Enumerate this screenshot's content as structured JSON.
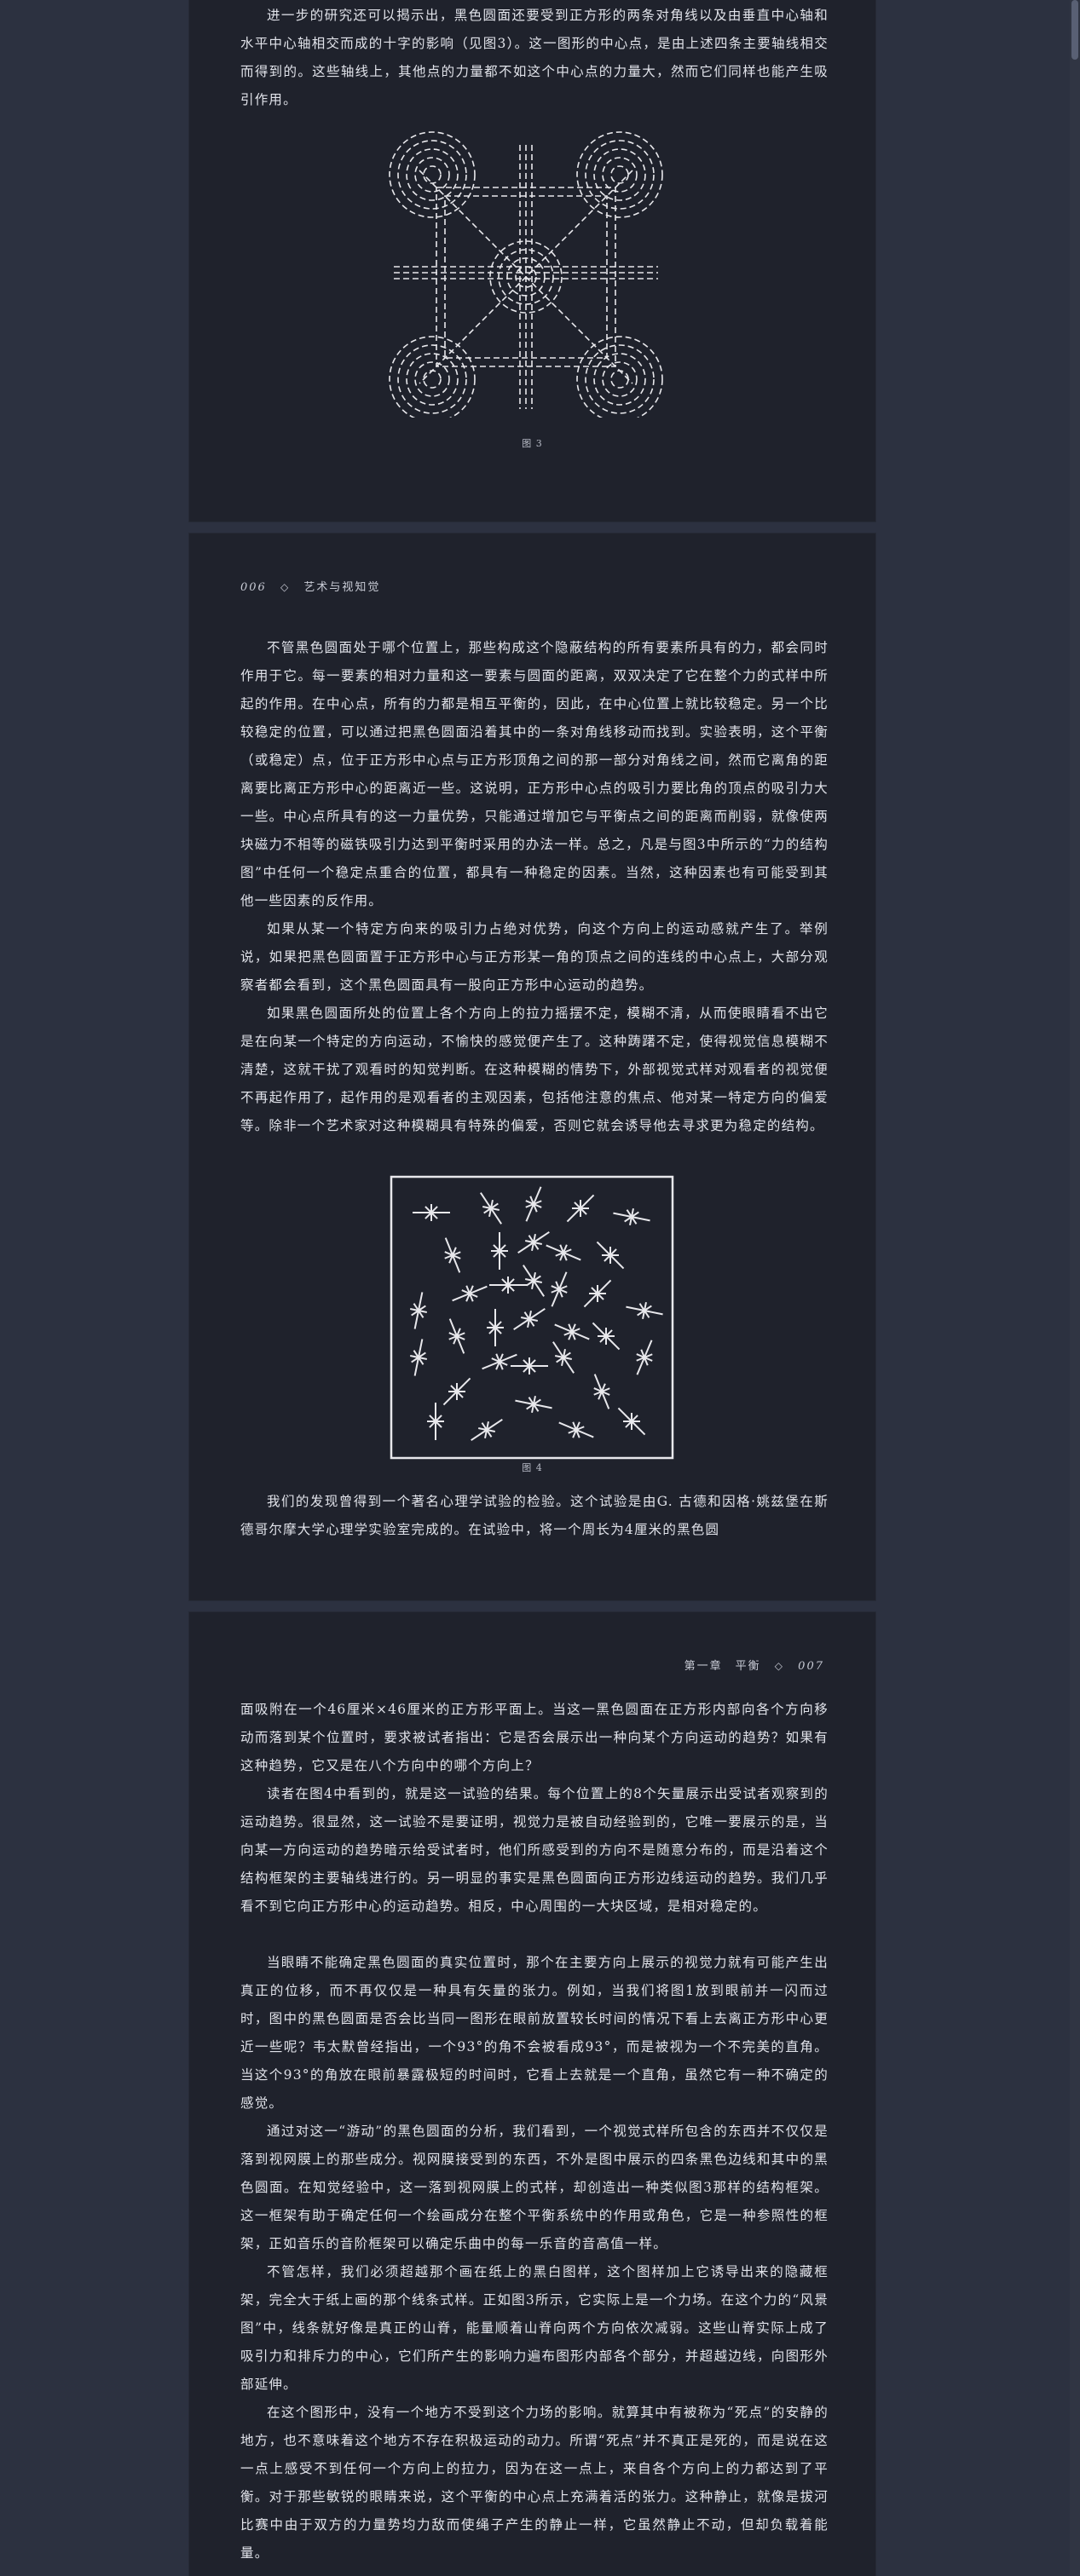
{
  "pages": [
    {
      "paragraphs": [
        "进一步的研究还可以揭示出，黑色圆面还要受到正方形的两条对角线以及由垂直中心轴和水平中心轴相交而成的十字的影响（见图3）。这一图形的中心点，是由上述四条主要轴线相交而得到的。这些轴线上，其他点的力量都不如这个中心点的力量大，然而它们同样也能产生吸引作用。"
      ],
      "figure_caption": "图 3"
    },
    {
      "header": {
        "page_number": "006",
        "book_title": "艺术与视知觉",
        "separator_icon": "hollow-diamond"
      },
      "paragraphs": [
        "不管黑色圆面处于哪个位置上，那些构成这个隐蔽结构的所有要素所具有的力，都会同时作用于它。每一要素的相对力量和这一要素与圆面的距离，双双决定了它在整个力的式样中所起的作用。在中心点，所有的力都是相互平衡的，因此，在中心位置上就比较稳定。另一个比较稳定的位置，可以通过把黑色圆面沿着其中的一条对角线移动而找到。实验表明，这个平衡（或稳定）点，位于正方形中心点与正方形顶角之间的那一部分对角线之间，然而它离角的距离要比离正方形中心的距离近一些。这说明，正方形中心点的吸引力要比角的顶点的吸引力大一些。中心点所具有的这一力量优势，只能通过增加它与平衡点之间的距离而削弱，就像使两块磁力不相等的磁铁吸引力达到平衡时采用的办法一样。总之，凡是与图3中所示的“力的结构图”中任何一个稳定点重合的位置，都具有一种稳定的因素。当然，这种因素也有可能受到其他一些因素的反作用。",
        "如果从某一个特定方向来的吸引力占绝对优势，向这个方向上的运动感就产生了。举例说，如果把黑色圆面置于正方形中心与正方形某一角的顶点之间的连线的中心点上，大部分观察者都会看到，这个黑色圆面具有一股向正方形中心运动的趋势。",
        "如果黑色圆面所处的位置上各个方向上的拉力摇摆不定，模糊不清，从而使眼睛看不出它是在向某一个特定的方向运动，不愉快的感觉便产生了。这种踌躇不定，使得视觉信息模糊不清楚，这就干扰了观看时的知觉判断。在这种模糊的情势下，外部视觉式样对观看者的视觉便不再起作用了，起作用的是观看者的主观因素，包括他注意的焦点、他对某一特定方向的偏爱等。除非一个艺术家对这种模糊具有特殊的偏爱，否则它就会诱导他去寻求更为稳定的结构。",
        "我们的发现曾得到一个著名心理学试验的检验。这个试验是由G. 古德和因格·姚兹堡在斯德哥尔摩大学心理学实验室完成的。在试验中，将一个周长为4厘米的黑色圆"
      ],
      "figure_caption": "图 4"
    },
    {
      "header": {
        "chapter": "第一章　平衡",
        "page_number": "007",
        "separator_icon": "hollow-diamond"
      },
      "paragraphs": [
        "面吸附在一个46厘米×46厘米的正方形平面上。当这一黑色圆面在正方形内部向各个方向移动而落到某个位置时，要求被试者指出：它是否会展示出一种向某个方向运动的趋势？如果有这种趋势，它又是在八个方向中的哪个方向上？",
        "读者在图4中看到的，就是这一试验的结果。每个位置上的8个矢量展示出受试者观察到的运动趋势。很显然，这一试验不是要证明，视觉力是被自动经验到的，它唯一要展示的是，当向某一方向运动的趋势暗示给受试者时，他们所感受到的方向不是随意分布的，而是沿着这个结构框架的主要轴线进行的。另一明显的事实是黑色圆面向正方形边线运动的趋势。我们几乎看不到它向正方形中心的运动趋势。相反，中心周围的一大块区域，是相对稳定的。",
        "当眼睛不能确定黑色圆面的真实位置时，那个在主要方向上展示的视觉力就有可能产生出真正的位移，而不再仅仅是一种具有矢量的张力。例如，当我们将图1放到眼前并一闪而过时，图中的黑色圆面是否会比当同一图形在眼前放置较长时间的情况下看上去离正方形中心更近一些呢？韦太默曾经指出，一个93°的角不会被看成93°，而是被视为一个不完美的直角。当这个93°的角放在眼前暴露极短的时间时，它看上去就是一个直角，虽然它有一种不确定的感觉。",
        "通过对这一“游动”的黑色圆面的分析，我们看到，一个视觉式样所包含的东西并不仅仅是落到视网膜上的那些成分。视网膜接受到的东西，不外是图中展示的四条黑色边线和其中的黑色圆面。在知觉经验中，这一落到视网膜上的式样，却创造出一种类似图3那样的结构框架。这一框架有助于确定任何一个绘画成分在整个平衡系统中的作用或角色，它是一种参照性的框架，正如音乐的音阶框架可以确定乐曲中的每一乐音的音高值一样。",
        "不管怎样，我们必须超越那个画在纸上的黑白图样，这个图样加上它诱导出来的隐藏框架，完全大于纸上画的那个线条式样。正如图3所示，它实际上是一个力场。在这个力的“风景图”中，线条就好像是真正的山脊，能量顺着山脊向两个方向依次减弱。这些山脊实际上成了吸引力和排斥力的中心，它们所产生的影响力遍布图形内部各个部分，并超越边线，向图形外部延伸。",
        "在这个图形中，没有一个地方不受到这个力场的影响。就算其中有被称为“死点”的安静的地方，也不意味着这个地方不存在积极运动的动力。所谓“死点”并不真正是死的，而是说在这一点上感受不到任何一个方向上的拉力，因为在这一点上，来自各个方向上的力都达到了平衡。对于那些敏锐的眼睛来说，这个平衡的中心点上充满着活的张力。这种静止，就像是拔河比赛中由于双方的力量势均力敌而使绳子产生的静止一样，它虽然静止不动，但却负载着能量。"
      ]
    }
  ],
  "colors": {
    "background": "#2c3140",
    "page": "#1f222c",
    "text": "#e1e3ea",
    "figure_line": "#e8e8ec"
  }
}
